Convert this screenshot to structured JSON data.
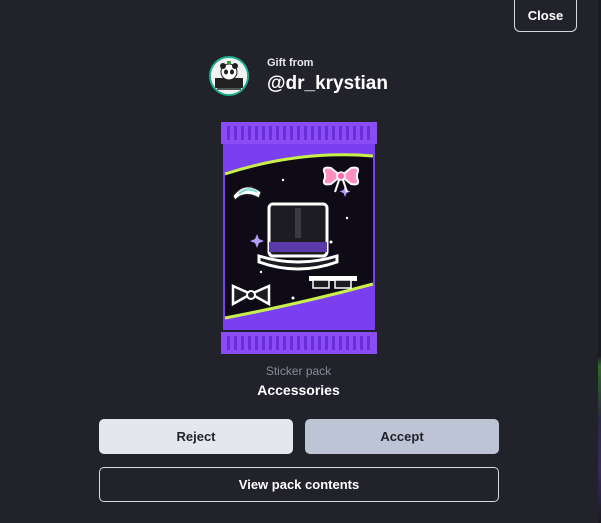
{
  "dialog": {
    "close_label": "Close",
    "gift_from_label": "Gift from",
    "sender_username": "@dr_krystian",
    "pack_type": "Sticker pack",
    "pack_name": "Accessories",
    "reject_label": "Reject",
    "accept_label": "Accept",
    "view_contents_label": "View pack contents"
  },
  "colors": {
    "background": "#22222b",
    "pack_purple": "#7a3ff0",
    "pack_accent_green": "#c8f04a",
    "reject_bg": "#e6e6ee",
    "accept_bg": "#bcc4d6",
    "avatar_ring": "#1fae8e"
  },
  "icons": {
    "avatar": "sender-avatar",
    "pack_art": "top-hat, pink-bow, black-bow-tie, pixel-sunglasses, tiara"
  }
}
